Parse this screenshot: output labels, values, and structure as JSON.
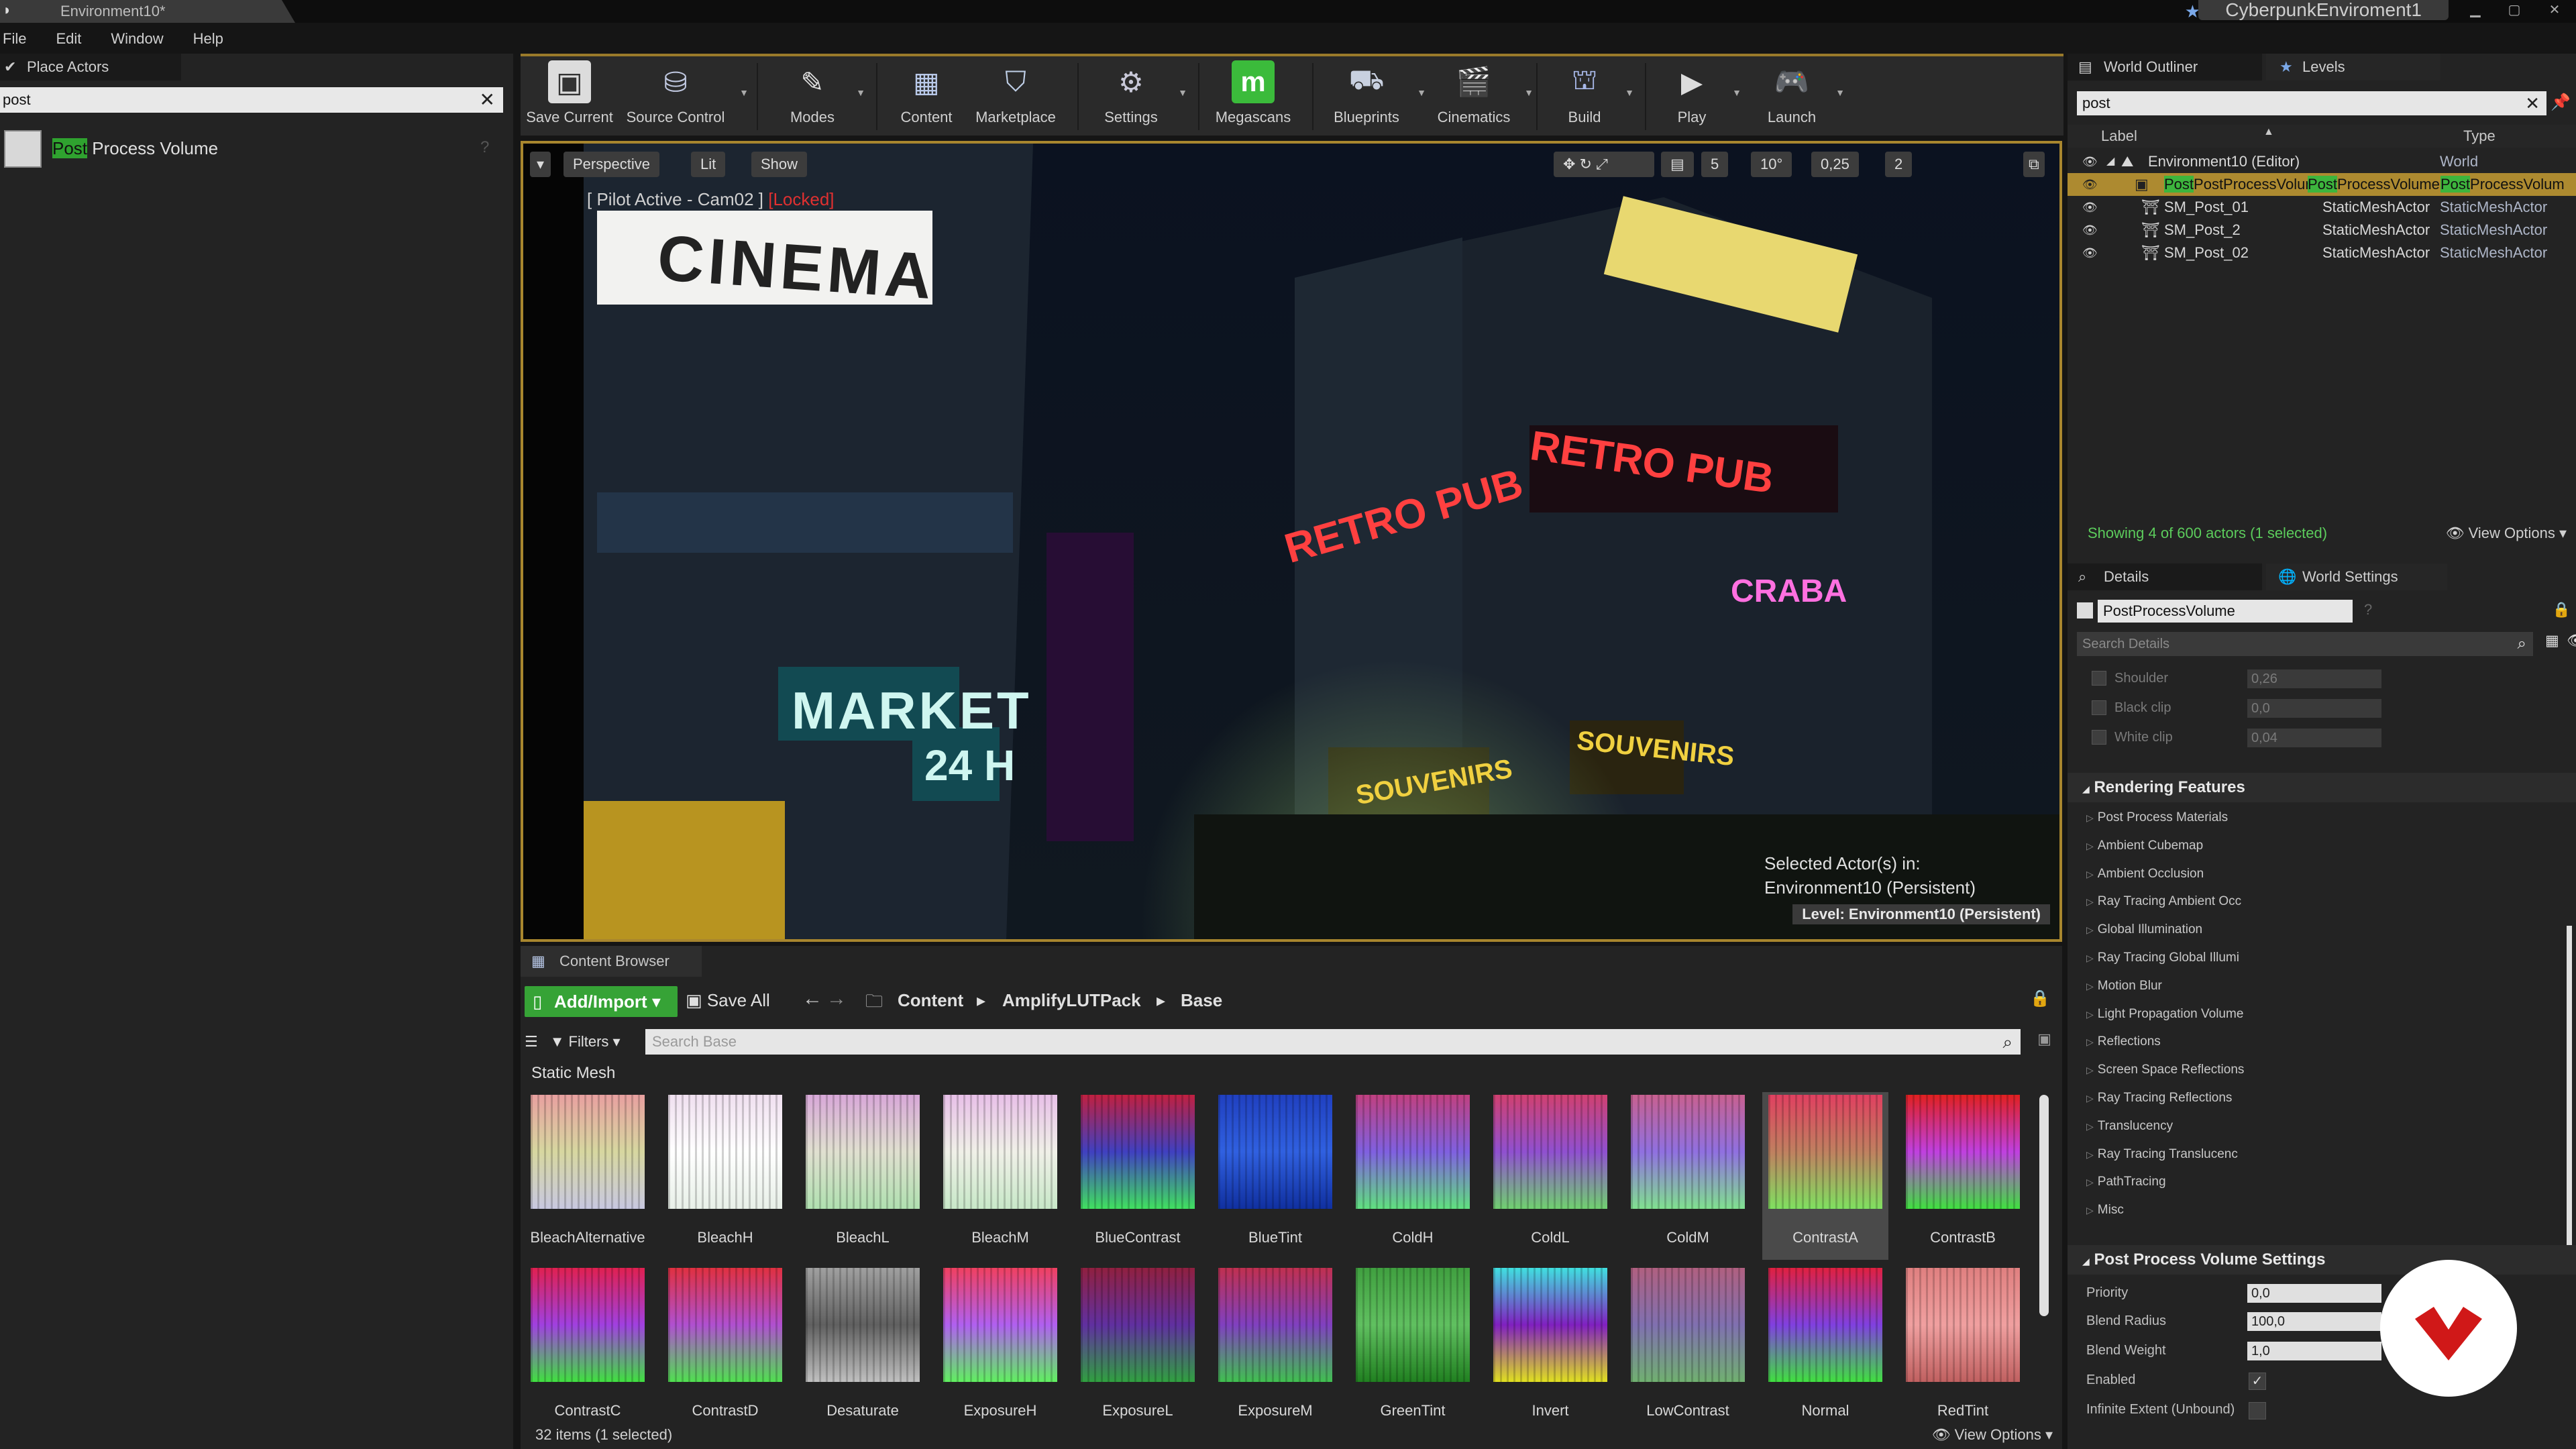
{
  "window": {
    "tab_title": "Environment10*",
    "project_name": "CyberpunkEnviroment1"
  },
  "menu": [
    "File",
    "Edit",
    "Window",
    "Help"
  ],
  "place_actors": {
    "tab_label": "Place Actors",
    "search_value": "post",
    "result": {
      "highlight": "Post",
      "rest": " Process Volume"
    }
  },
  "toolbar": [
    {
      "label": "Save Current",
      "icon": "save-icon"
    },
    {
      "label": "Source Control",
      "icon": "source-control-icon"
    },
    {
      "label": "Modes",
      "icon": "modes-icon"
    },
    {
      "label": "Content",
      "icon": "content-icon"
    },
    {
      "label": "Marketplace",
      "icon": "marketplace-icon"
    },
    {
      "label": "Settings",
      "icon": "settings-icon"
    },
    {
      "label": "Megascans",
      "icon": "megascans-icon"
    },
    {
      "label": "Blueprints",
      "icon": "blueprints-icon"
    },
    {
      "label": "Cinematics",
      "icon": "cinematics-icon"
    },
    {
      "label": "Build",
      "icon": "build-icon"
    },
    {
      "label": "Play",
      "icon": "play-icon"
    },
    {
      "label": "Launch",
      "icon": "launch-icon"
    }
  ],
  "viewport": {
    "perspective": "Perspective",
    "lit": "Lit",
    "show": "Show",
    "grid_value": "10°",
    "scale_value": "0,25",
    "camera_speed": "2",
    "snap_count": "5",
    "pilot_text": "[ Pilot Active - Cam02 ]",
    "locked_text": "[Locked]",
    "selected_line1": "Selected Actor(s) in:",
    "selected_line2": "Environment10 (Persistent)",
    "level_label": "Level:  Environment10 (Persistent)",
    "signs": [
      "CINEMA",
      "MARKET",
      "24 H",
      "RETRO PUB",
      "RETRO PUB",
      "SOUVENIRS",
      "SOUVENIRS",
      "CRABA"
    ]
  },
  "content_browser": {
    "tab_label": "Content Browser",
    "add_import": "Add/Import",
    "save_all": "Save All",
    "breadcrumbs": [
      "Content",
      "AmplifyLUTPack",
      "Base"
    ],
    "filters": "Filters",
    "search_placeholder": "Search Base",
    "category": "Static Mesh",
    "assets": [
      {
        "name": "BleachAlternative",
        "colors": [
          "#e8a0a0",
          "#d7d7a0",
          "#c8c8e0"
        ]
      },
      {
        "name": "BleachH",
        "colors": [
          "#f0e0f0",
          "#ffffff",
          "#e8f0e8"
        ]
      },
      {
        "name": "BleachL",
        "colors": [
          "#d8a8d8",
          "#e0e0d0",
          "#b0e0b0"
        ]
      },
      {
        "name": "BleachM",
        "colors": [
          "#e8c0e8",
          "#f0f0e8",
          "#c8e8c8"
        ]
      },
      {
        "name": "BlueContrast",
        "colors": [
          "#c02040",
          "#4040c0",
          "#40e060"
        ]
      },
      {
        "name": "BlueTint",
        "colors": [
          "#2040c0",
          "#3060e0",
          "#1030a0"
        ]
      },
      {
        "name": "ColdH",
        "colors": [
          "#c04080",
          "#8060e0",
          "#60e080"
        ]
      },
      {
        "name": "ColdL",
        "colors": [
          "#d04070",
          "#9050d0",
          "#70d070"
        ]
      },
      {
        "name": "ColdM",
        "colors": [
          "#c86090",
          "#9070e0",
          "#80e090"
        ]
      },
      {
        "name": "ContrastA",
        "colors": [
          "#e04060",
          "#c08060",
          "#80e060"
        ]
      },
      {
        "name": "ContrastB",
        "colors": [
          "#e02020",
          "#c040e0",
          "#40e040"
        ]
      },
      {
        "name": "ContrastC",
        "colors": [
          "#e02050",
          "#a040e0",
          "#40e040"
        ]
      },
      {
        "name": "ContrastD",
        "colors": [
          "#e03040",
          "#b050d0",
          "#50e050"
        ]
      },
      {
        "name": "Desaturate",
        "colors": [
          "#a0a0a0",
          "#606060",
          "#c0c0c0"
        ]
      },
      {
        "name": "ExposureH",
        "colors": [
          "#f04060",
          "#b060f0",
          "#60f060"
        ]
      },
      {
        "name": "ExposureL",
        "colors": [
          "#902040",
          "#6030a0",
          "#30a040"
        ]
      },
      {
        "name": "ExposureM",
        "colors": [
          "#c03050",
          "#8040c0",
          "#40c050"
        ]
      },
      {
        "name": "GreenTint",
        "colors": [
          "#40a040",
          "#60c060",
          "#208020"
        ]
      },
      {
        "name": "Invert",
        "colors": [
          "#40e0e0",
          "#8020c0",
          "#e0e020"
        ]
      },
      {
        "name": "LowContrast",
        "colors": [
          "#b06080",
          "#8070b0",
          "#70b070"
        ]
      },
      {
        "name": "Normal",
        "colors": [
          "#e02040",
          "#8040e0",
          "#40e040"
        ]
      },
      {
        "name": "RedTint",
        "colors": [
          "#e08080",
          "#f0a0a0",
          "#c06060"
        ]
      }
    ],
    "footer": "32 items (1 selected)",
    "view_options": "View Options"
  },
  "world_outliner": {
    "tab_label": "World Outliner",
    "levels_tab": "Levels",
    "search_value": "post",
    "col_label": "Label",
    "col_type": "Type",
    "rows": [
      {
        "label": "Environment10 (Editor)",
        "type": "World"
      },
      {
        "label": "PostProcessVolun",
        "type": "PostProcessVolume"
      },
      {
        "label": "SM_Post_01",
        "type": "StaticMeshActor"
      },
      {
        "label": "SM_Post_2",
        "type": "StaticMeshActor"
      },
      {
        "label": "SM_Post_02",
        "type": "StaticMeshActor"
      }
    ],
    "status": "Showing 4 of 600 actors (1 selected)",
    "view_options": "View Options"
  },
  "details": {
    "tab_label": "Details",
    "world_settings_tab": "World Settings",
    "object_name": "PostProcessVolume",
    "search_placeholder": "Search Details",
    "top_props": [
      {
        "label": "Shoulder",
        "value": "0,26"
      },
      {
        "label": "Black clip",
        "value": "0,0"
      },
      {
        "label": "White clip",
        "value": "0,04"
      }
    ],
    "rendering_title": "Rendering Features",
    "features": [
      "Post Process Materials",
      "Ambient Cubemap",
      "Ambient Occlusion",
      "Ray Tracing Ambient Occ",
      "Global Illumination",
      "Ray Tracing Global Illumi",
      "Motion Blur",
      "Light Propagation Volume",
      "Reflections",
      "Screen Space Reflections",
      "Ray Tracing Reflections",
      "Translucency",
      "Ray Tracing Translucenc",
      "PathTracing",
      "Misc"
    ],
    "ppv_title": "Post Process Volume Settings",
    "ppv_props": [
      {
        "label": "Priority",
        "value": "0,0"
      },
      {
        "label": "Blend Radius",
        "value": "100,0"
      },
      {
        "label": "Blend Weight",
        "value": "1,0"
      }
    ],
    "enabled_label": "Enabled",
    "unbound_label": "Infinite Extent (Unbound)"
  }
}
